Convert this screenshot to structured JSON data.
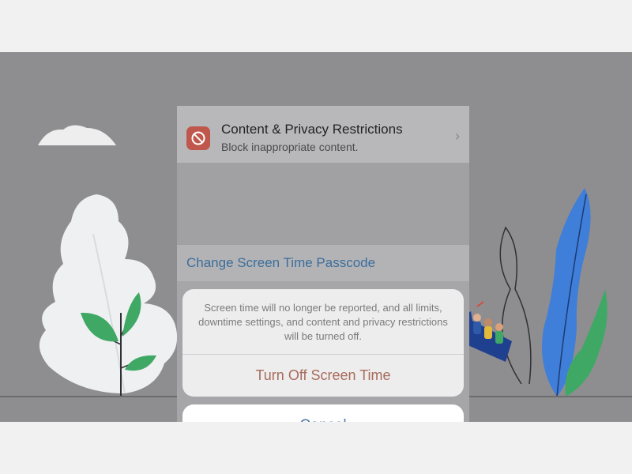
{
  "settings": {
    "restrictions": {
      "icon": "restriction-icon",
      "title": "Content & Privacy Restrictions",
      "subtitle": "Block inappropriate content.",
      "chevron": "›"
    },
    "passcode_link": "Change Screen Time Passcode"
  },
  "alert": {
    "message": "Screen time will no longer be reported, and all limits, downtime settings, and content and privacy restrictions will be turned off.",
    "turn_off_label": "Turn Off Screen Time",
    "cancel_label": "Cancel"
  },
  "colors": {
    "background": "#8e8e90",
    "destructive": "#a86b5c",
    "action_blue": "#4f79a8",
    "restriction_icon": "#c0574c",
    "arrow_blue": "#1f3f8f",
    "leaf_green": "#3fa865",
    "leaf_blue": "#3f7ed9"
  }
}
